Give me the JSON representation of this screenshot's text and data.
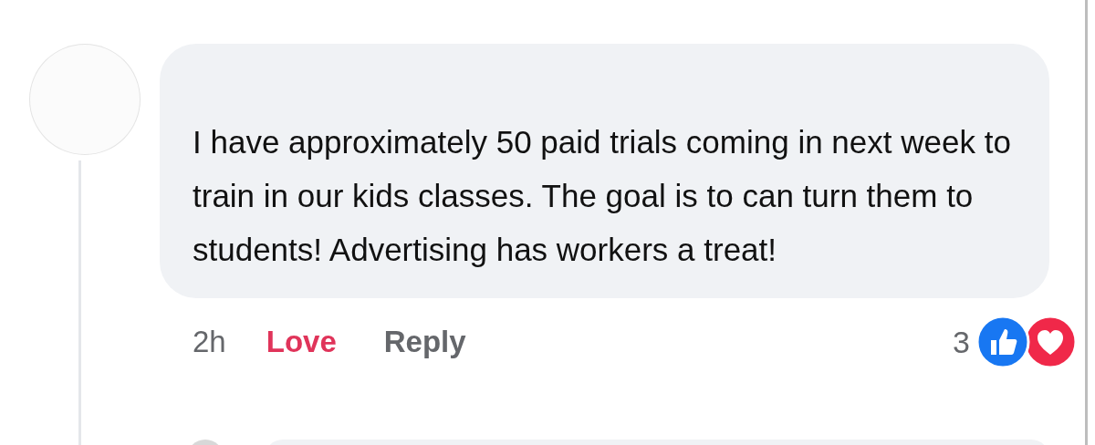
{
  "comment": {
    "text": "I have approximately 50 paid trials coming in next week to train in our kids classes. The goal is to can turn them to students! Advertising has workers a treat!",
    "time": "2h",
    "reaction": {
      "label": "Love",
      "selected": true
    },
    "reply": "Reply",
    "reaction_count": "3",
    "reaction_icons": [
      {
        "kind": "like"
      },
      {
        "kind": "love"
      }
    ]
  }
}
